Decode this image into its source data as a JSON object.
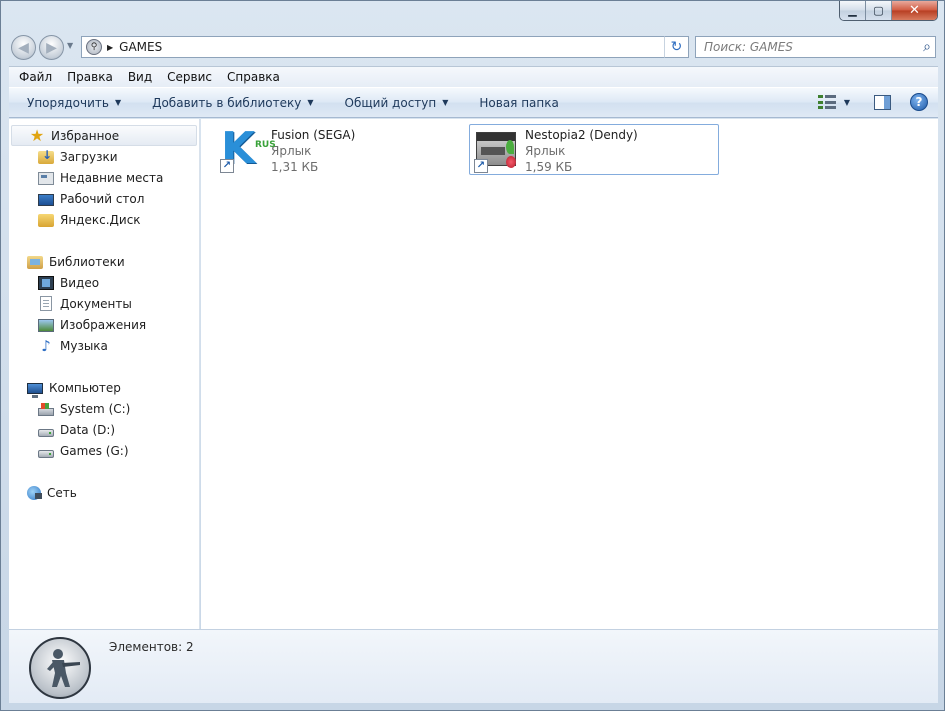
{
  "window": {
    "minimize_glyph": "▁",
    "maximize_glyph": "▢",
    "close_glyph": "✕"
  },
  "address": {
    "path": "GAMES",
    "back_glyph": "◀",
    "forward_glyph": "▶",
    "dropdown_glyph": "▼",
    "separator_glyph": "▶",
    "refresh_glyph": "↻"
  },
  "search": {
    "placeholder": "Поиск: GAMES",
    "icon_glyph": "⌕"
  },
  "menu": {
    "items": [
      "Файл",
      "Правка",
      "Вид",
      "Сервис",
      "Справка"
    ]
  },
  "commands": {
    "organize": "Упорядочить",
    "add_library": "Добавить в библиотеку",
    "share": "Общий доступ",
    "new_folder": "Новая папка",
    "arrow": "▼",
    "help": "?"
  },
  "navigation": {
    "favorites": {
      "label": "Избранное",
      "items": [
        "Загрузки",
        "Недавние места",
        "Рабочий стол",
        "Яндекс.Диск"
      ]
    },
    "libraries": {
      "label": "Библиотеки",
      "items": [
        "Видео",
        "Документы",
        "Изображения",
        "Музыка"
      ]
    },
    "computer": {
      "label": "Компьютер",
      "items": [
        "System (C:)",
        "Data (D:)",
        "Games (G:)"
      ]
    },
    "network": {
      "label": "Сеть"
    },
    "star_glyph": "★",
    "music_glyph": "♪"
  },
  "files": [
    {
      "name": "Fusion (SEGA)",
      "type": "Ярлык",
      "size": "1,31 КБ",
      "icon": "kega-fusion-icon",
      "logo_letter": "K",
      "logo_sub": "RUS"
    },
    {
      "name": "Nestopia2 (Dendy)",
      "type": "Ярлык",
      "size": "1,59 КБ",
      "icon": "nes-console-icon"
    }
  ],
  "shortcut_glyph": "↗",
  "details": {
    "items_count": "Элементов: 2"
  }
}
